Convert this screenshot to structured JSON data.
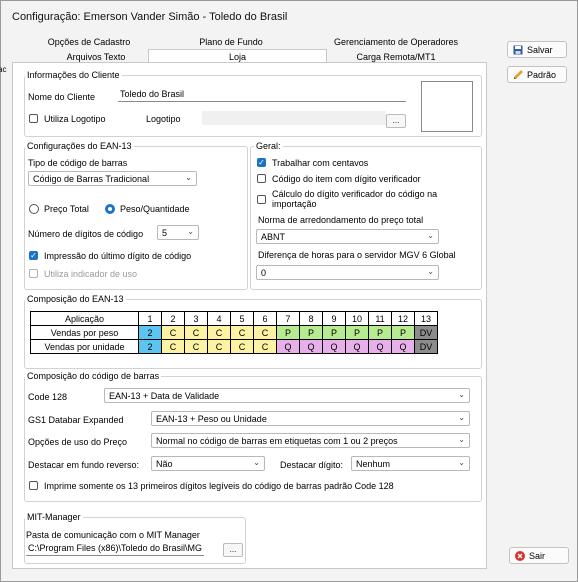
{
  "window": {
    "title": "Configuração: Emerson Vander Simão - Toledo do Brasil"
  },
  "tabs": {
    "row1": [
      "Opções de Cadastro",
      "Plano de Fundo",
      "Gerenciamento de Operadores"
    ],
    "row2": [
      "Arquivos Texto",
      "Loja",
      "Carga Remota/MT1"
    ],
    "active": "Loja"
  },
  "stray_text": "ac",
  "buttons": {
    "save": "Salvar",
    "default": "Padrão",
    "exit": "Sair",
    "browse": "...",
    "mit_browse": "..."
  },
  "cliente": {
    "group": "Informações do Cliente",
    "name_label": "Nome do Cliente",
    "name_value": "Toledo do Brasil",
    "use_logo_label": "Utiliza Logotipo",
    "use_logo_checked": false,
    "logo_label": "Logotipo"
  },
  "ean13": {
    "group": "Configurações do EAN-13",
    "barcode_type_label": "Tipo de código de barras",
    "barcode_type_value": "Código de Barras Tradicional",
    "radio_total": "Preço Total",
    "radio_peso": "Peso/Quantidade",
    "radio_selected": "Peso/Quantidade",
    "digits_label": "Número de dígitos de código",
    "digits_value": "5",
    "print_last_digit": "Impressão do último dígito de código",
    "print_last_digit_checked": true,
    "use_indicator": "Utiliza indicador de uso",
    "use_indicator_checked": false
  },
  "geral": {
    "group": "Geral:",
    "cents": "Trabalhar com centavos",
    "cents_checked": true,
    "check_digit": "Código do item com dígito verificador",
    "check_digit_checked": false,
    "import_calc": "Cálculo do dígito verificador do código na importação",
    "import_calc_checked": false,
    "rounding_label": "Norma de arredondamento do preço total",
    "rounding_value": "ABNT",
    "hours_label": "Diferença de horas para o servidor MGV 6 Global",
    "hours_value": "0"
  },
  "composition": {
    "group": "Composição do EAN-13",
    "header": [
      "Aplicação",
      "1",
      "2",
      "3",
      "4",
      "5",
      "6",
      "7",
      "8",
      "9",
      "10",
      "11",
      "12",
      "13"
    ],
    "rows": [
      {
        "label": "Vendas por peso",
        "cells": [
          "2",
          "C",
          "C",
          "C",
          "C",
          "C",
          "P",
          "P",
          "P",
          "P",
          "P",
          "P",
          "DV"
        ]
      },
      {
        "label": "Vendas por unidade",
        "cells": [
          "2",
          "C",
          "C",
          "C",
          "C",
          "C",
          "Q",
          "Q",
          "Q",
          "Q",
          "Q",
          "Q",
          "DV"
        ]
      }
    ],
    "colors": {
      "blue": "#5bc4f1",
      "yellow": "#fbf3a3",
      "green": "#b7eb8f",
      "pink": "#e7b0ea",
      "dv": "#8c8c8c"
    }
  },
  "barcode": {
    "group": "Composição do código de barras",
    "code128_label": "Code 128",
    "code128_value": "EAN-13 + Data de Validade",
    "gs1_label": "GS1 Databar Expanded",
    "gs1_value": "EAN-13 + Peso ou Unidade",
    "price_label": "Opções de uso do Preço",
    "price_value": "Normal no código de barras em etiquetas com 1 ou 2 preços",
    "reverse_label": "Destacar em fundo reverso:",
    "reverse_value": "Não",
    "digit_label": "Destacar dígito:",
    "digit_value": "Nenhum",
    "print13_label": "Imprime somente os 13 primeiros dígitos legíveis do código de barras padrão Code 128",
    "print13_checked": false
  },
  "mit": {
    "group": "MIT-Manager",
    "folder_label": "Pasta de comunicação com o MIT Manager",
    "folder_value": "C:\\Program Files (x86)\\Toledo do Brasil\\MG"
  }
}
